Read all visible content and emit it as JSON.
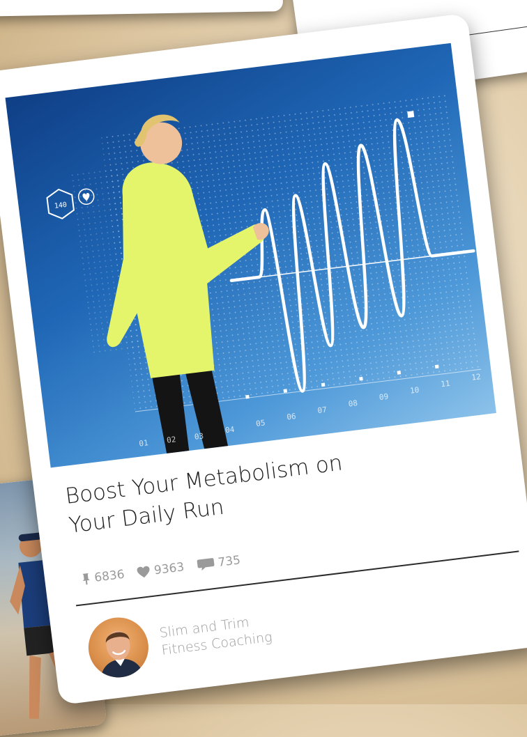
{
  "post": {
    "title_line1": "Boost Your Metabolism on",
    "title_line2": "Your Daily Run",
    "stats": {
      "pins": "6836",
      "likes": "9363",
      "comments": "735"
    },
    "author": {
      "name_line1": "Slim and Trim",
      "name_line2": "Fitness Coaching"
    }
  },
  "hero": {
    "badge_value": "140",
    "axis_labels": [
      "01",
      "02",
      "03",
      "04",
      "05",
      "06",
      "07",
      "08",
      "09",
      "10",
      "11",
      "12"
    ]
  },
  "icons": {
    "pin": "pin-icon",
    "heart": "heart-icon",
    "comment": "comment-icon"
  },
  "colors": {
    "hero_blue": "#1f67b6",
    "jacket": "#e4f56c",
    "stat_gray": "#9a9a9a"
  }
}
